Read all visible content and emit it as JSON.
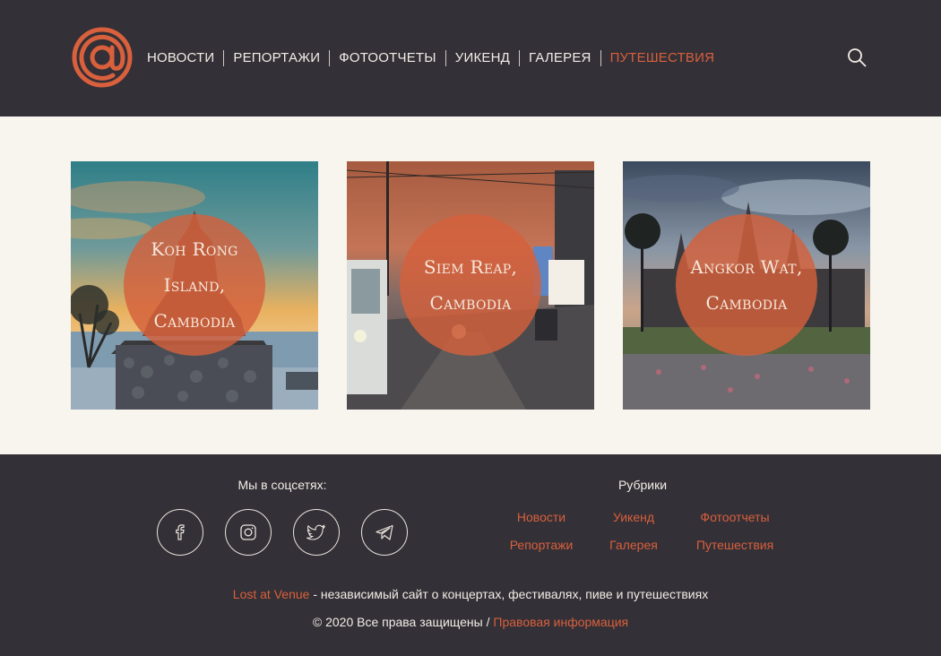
{
  "brand": {
    "logo_icon": "at-sign-logo",
    "accent_color": "#d9603c",
    "bg_dark": "#333037"
  },
  "nav": {
    "items": [
      {
        "label": "НОВОСТИ"
      },
      {
        "label": "РЕПОРТАЖИ"
      },
      {
        "label": "ФОТООТЧЕТЫ"
      },
      {
        "label": "УИКЕНД"
      },
      {
        "label": "ГАЛЕРЕЯ"
      },
      {
        "label": "ПУТЕШЕСТВИЯ",
        "active": true
      }
    ],
    "search_icon": "search-icon"
  },
  "cards": [
    {
      "title": "Koh Rong Island,\nCambodia"
    },
    {
      "title": "Siem Reap,\nCambodia"
    },
    {
      "title": "Angkor Wat,\nCambodia"
    }
  ],
  "footer": {
    "social_title": "Мы в соцсетях:",
    "social": [
      "facebook-icon",
      "instagram-icon",
      "twitter-icon",
      "telegram-icon"
    ],
    "rubrics_title": "Рубрики",
    "rubrics": [
      "Новости",
      "Уикенд",
      "Фотоотчеты",
      "Репортажи",
      "Галерея",
      "Путешествия"
    ],
    "about_link": "Lost at Venue",
    "about_text": " - независимый сайт о концертах, фестивалях, пиве и путешествиях",
    "copyright": "© 2020 Все права защищены / ",
    "legal_link": "Правовая информация"
  }
}
